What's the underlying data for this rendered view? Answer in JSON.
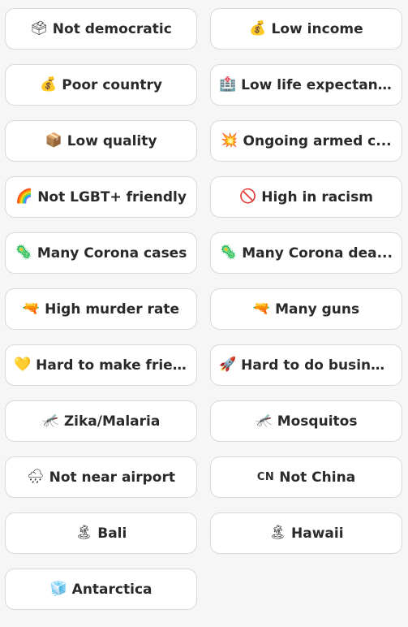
{
  "filters": [
    {
      "name": "not-democratic",
      "icon": "🗳",
      "label": "Not democratic"
    },
    {
      "name": "low-income",
      "icon": "💰",
      "label": "Low income"
    },
    {
      "name": "poor-country",
      "icon": "💰",
      "label": "Poor country"
    },
    {
      "name": "low-life-expectancy",
      "icon": "🏥",
      "label": "Low life expectan..."
    },
    {
      "name": "low-quality",
      "icon": "📦",
      "label": "Low quality"
    },
    {
      "name": "ongoing-armed-conflict",
      "icon": "💥",
      "label": "Ongoing armed c..."
    },
    {
      "name": "not-lgbt-friendly",
      "icon": "🌈",
      "label": "Not LGBT+ friendly"
    },
    {
      "name": "high-in-racism",
      "icon": "🚫",
      "label": "High in racism"
    },
    {
      "name": "many-corona-cases",
      "icon": "🦠",
      "label": "Many Corona cases"
    },
    {
      "name": "many-corona-deaths",
      "icon": "🦠",
      "label": "Many Corona dea..."
    },
    {
      "name": "high-murder-rate",
      "icon": "🔫",
      "label": "High murder rate"
    },
    {
      "name": "many-guns",
      "icon": "🔫",
      "label": "Many guns"
    },
    {
      "name": "hard-to-make-friends",
      "icon": "💛",
      "label": "Hard to make frie..."
    },
    {
      "name": "hard-to-do-business",
      "icon": "🚀",
      "label": "Hard to do busine..."
    },
    {
      "name": "zika-malaria",
      "icon": "🦟",
      "label": "Zika/Malaria"
    },
    {
      "name": "mosquitos",
      "icon": "🦟",
      "label": "Mosquitos"
    },
    {
      "name": "not-near-airport",
      "icon": "🌧",
      "label": "Not near airport"
    },
    {
      "name": "not-china",
      "icon": "CN",
      "label": "Not China"
    },
    {
      "name": "bali",
      "icon": "🏝",
      "label": "Bali"
    },
    {
      "name": "hawaii",
      "icon": "🏝",
      "label": "Hawaii"
    },
    {
      "name": "antarctica",
      "icon": "🧊",
      "label": "Antarctica"
    }
  ]
}
